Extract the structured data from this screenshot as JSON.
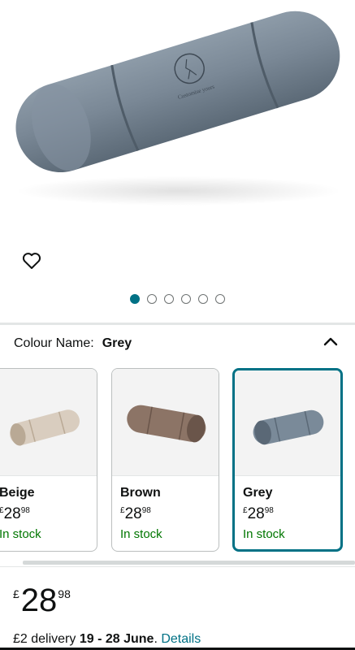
{
  "product": {
    "image_alt": "Grey velvet bolster pillow",
    "logo_text": "Customise yours"
  },
  "gallery": {
    "total_images": 6,
    "active_index": 0
  },
  "colour": {
    "label": "Colour Name:",
    "selected": "Grey",
    "options": [
      {
        "name": "Beige",
        "currency": "£",
        "whole": "28",
        "fraction": "98",
        "stock": "In stock",
        "color": "#d9cdbf",
        "shade": "#b9a995"
      },
      {
        "name": "Brown",
        "currency": "£",
        "whole": "28",
        "fraction": "98",
        "stock": "In stock",
        "color": "#8c7466",
        "shade": "#6a554a"
      },
      {
        "name": "Grey",
        "currency": "£",
        "whole": "28",
        "fraction": "98",
        "stock": "In stock",
        "color": "#7a8a99",
        "shade": "#5a6876"
      }
    ]
  },
  "price": {
    "currency": "£",
    "whole": "28",
    "fraction": "98"
  },
  "delivery": {
    "prefix": "£2 delivery ",
    "dates": "19 - 28 June",
    "suffix": ". ",
    "link": "Details"
  },
  "colors": {
    "accent": "#007185",
    "in_stock": "#007600"
  },
  "icons": {
    "wishlist": "heart-icon",
    "collapse": "chevron-up-icon"
  }
}
